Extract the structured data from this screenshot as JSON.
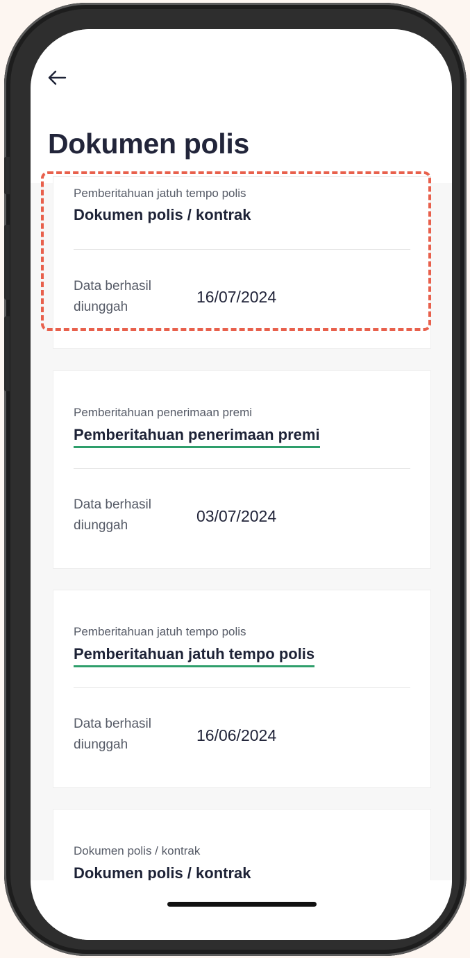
{
  "header": {
    "back_icon": "arrow-left-icon",
    "title": "Dokumen polis"
  },
  "cards": [
    {
      "label": "Pemberitahuan jatuh tempo polis",
      "link": "Dokumen polis / kontrak",
      "meta_label": "Data berhasil diunggah",
      "date": "16/07/2024",
      "highlighted": true
    },
    {
      "label": "Pemberitahuan penerimaan premi",
      "link": "Pemberitahuan penerimaan premi",
      "meta_label": "Data berhasil diunggah",
      "date": "03/07/2024"
    },
    {
      "label": "Pemberitahuan jatuh tempo polis",
      "link": "Pemberitahuan jatuh tempo polis",
      "meta_label": "Data berhasil diunggah",
      "date": "16/06/2024"
    },
    {
      "label": "Dokumen polis / kontrak",
      "link": "Dokumen polis / kontrak"
    }
  ],
  "colors": {
    "accent_underline": "#2e9e6b",
    "highlight_border": "#e8604c",
    "title_text": "#22253a",
    "phone_frame": "#2e2e2e"
  }
}
